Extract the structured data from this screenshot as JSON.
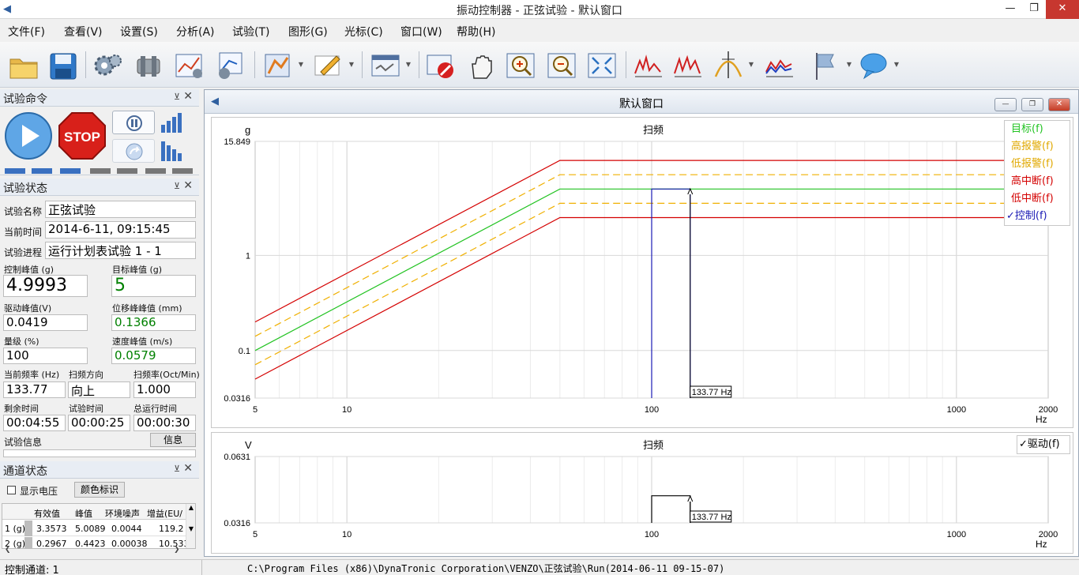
{
  "window": {
    "title": "振动控制器 - 正弦试验 - 默认窗口"
  },
  "menu": [
    "文件(F)",
    "查看(V)",
    "设置(S)",
    "分析(A)",
    "试验(T)",
    "图形(G)",
    "光标(C)",
    "窗口(W)",
    "帮助(H)"
  ],
  "toolbar": {
    "icons": [
      "open-folder-icon",
      "save-disk-icon",
      "gears-icon",
      "cylinder-icon",
      "profile-settings-icon",
      "schedule-settings-icon",
      "analysis-icon",
      "edit-pencil-icon",
      "window-layout-icon",
      "stop-record-icon",
      "hand-pan-icon",
      "zoom-in-icon",
      "zoom-out-icon",
      "fit-view-icon",
      "plot-1-icon",
      "plot-2-icon",
      "cursor-peak-icon",
      "plot-3-icon",
      "flag-icon",
      "speech-bubble-icon"
    ]
  },
  "test_command": {
    "title": "试验命令",
    "stop_label": "STOP"
  },
  "test_status": {
    "title": "试验状态",
    "name_label": "试验名称",
    "name_value": "正弦试验",
    "time_label": "当前时间",
    "time_value": "2014-6-11, 09:15:45",
    "progress_label": "试验进程",
    "progress_value": "运行计划表试验 1 - 1",
    "control_peak_label": "控制峰值 (g)",
    "control_peak_value": "4.9993",
    "target_peak_label": "目标峰值 (g)",
    "target_peak_value": "5",
    "drive_peak_label": "驱动峰值(V)",
    "drive_peak_value": "0.0419",
    "disp_peak_label": "位移峰峰值 (mm)",
    "disp_peak_value": "0.1366",
    "level_label": "量级 (%)",
    "level_value": "100",
    "vel_peak_label": "速度峰值 (m/s)",
    "vel_peak_value": "0.0579",
    "freq_label": "当前频率 (Hz)",
    "freq_value": "133.77",
    "dir_label": "扫频方向",
    "dir_value": "向上",
    "rate_label": "扫频率(Oct/Min)",
    "rate_value": "1.000",
    "remain_label": "剩余时间",
    "remain_value": "00:04:55",
    "test_time_label": "试验时间",
    "test_time_value": "00:00:25",
    "total_time_label": "总运行时间",
    "total_time_value": "00:00:30",
    "info_label": "试验信息",
    "info_button": "信息"
  },
  "channel_status": {
    "title": "通道状态",
    "show_voltage": "显示电压",
    "color_mark": "颜色标识",
    "columns": [
      "",
      "有效值",
      "峰值",
      "环境噪声",
      "增益(EU/"
    ],
    "rows": [
      [
        "1 (g)",
        "3.3573",
        "5.0089",
        "0.0044",
        "119.2"
      ],
      [
        "2 (g)",
        "0.2967",
        "0.4423",
        "0.00038",
        "10.533"
      ]
    ]
  },
  "mdi": {
    "title": "默认窗口"
  },
  "chart_data": [
    {
      "type": "line",
      "title": "扫频",
      "ylabel": "g",
      "xlabel": "Hz",
      "x_scale": "log",
      "y_scale": "log",
      "xlim": [
        5,
        2000
      ],
      "ylim": [
        0.0316,
        15.849
      ],
      "x_ticks": [
        "5",
        "10",
        "100",
        "1000",
        "2000"
      ],
      "y_ticks": [
        "15.849",
        "1",
        "0.1",
        "0.0316"
      ],
      "grid": true,
      "legend_position": "top-right",
      "series": [
        {
          "name": "目标(f)",
          "color": "#22c322",
          "style": "solid",
          "x": [
            5,
            50,
            2000
          ],
          "y": [
            0.1,
            5,
            5
          ]
        },
        {
          "name": "高报警(f)",
          "color": "#f0b000",
          "style": "dashed",
          "x": [
            5,
            50,
            2000
          ],
          "y": [
            0.141,
            7.07,
            7.07
          ]
        },
        {
          "name": "低报警(f)",
          "color": "#f0b000",
          "style": "dashed",
          "x": [
            5,
            50,
            2000
          ],
          "y": [
            0.0708,
            3.54,
            3.54
          ]
        },
        {
          "name": "高中断(f)",
          "color": "#d40000",
          "style": "solid",
          "x": [
            5,
            50,
            2000
          ],
          "y": [
            0.2,
            10,
            10
          ]
        },
        {
          "name": "低中断(f)",
          "color": "#d40000",
          "style": "solid",
          "x": [
            5,
            50,
            2000
          ],
          "y": [
            0.05,
            2.5,
            2.5
          ]
        },
        {
          "name": "控制(f)",
          "color": "#1a1ab4",
          "style": "solid",
          "x": [
            100,
            100,
            133.77,
            133.77
          ],
          "y": [
            0.0316,
            5,
            5,
            0.0316
          ]
        }
      ],
      "cursor": {
        "x": 133.77,
        "label": "133.77 Hz"
      }
    },
    {
      "type": "line",
      "title": "扫频",
      "ylabel": "V",
      "xlabel": "Hz",
      "x_scale": "log",
      "y_scale": "log",
      "xlim": [
        5,
        2000
      ],
      "ylim": [
        0.0316,
        0.0631
      ],
      "x_ticks": [
        "5",
        "10",
        "100",
        "1000",
        "2000"
      ],
      "y_ticks": [
        "0.0631",
        "0.0316"
      ],
      "grid": true,
      "legend_position": "top-right",
      "series": [
        {
          "name": "驱动(f)",
          "color": "#000000",
          "style": "solid",
          "x": [
            100,
            100,
            133.77,
            133.77
          ],
          "y": [
            0.0316,
            0.0419,
            0.0419,
            0.0316
          ]
        }
      ],
      "cursor": {
        "x": 133.77,
        "label": "133.77 Hz"
      }
    }
  ],
  "statusbar": {
    "channel": "控制通道: 1",
    "path": "C:\\Program Files (x86)\\DynaTronic Corporation\\VENZO\\正弦试验\\Run(2014-06-11 09-15-07)"
  }
}
